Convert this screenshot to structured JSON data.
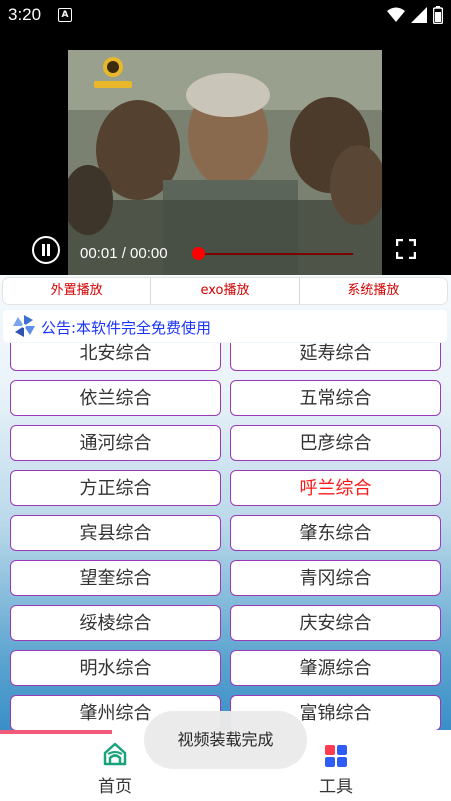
{
  "status_bar": {
    "time": "3:20",
    "notification_badge": "A"
  },
  "player": {
    "time_display": "00:01 / 00:00",
    "channel_logo_icon": "tv-station-logo"
  },
  "play_mode_tabs": [
    {
      "label": "外置播放"
    },
    {
      "label": "exo播放"
    },
    {
      "label": "系统播放"
    }
  ],
  "notice": {
    "text": "公告:本软件完全免费使用",
    "icon": "pinwheel-icon"
  },
  "channels": [
    {
      "label": "北安综合",
      "active": false
    },
    {
      "label": "延寿综合",
      "active": false
    },
    {
      "label": "依兰综合",
      "active": false
    },
    {
      "label": "五常综合",
      "active": false
    },
    {
      "label": "通河综合",
      "active": false
    },
    {
      "label": "巴彦综合",
      "active": false
    },
    {
      "label": "方正综合",
      "active": false
    },
    {
      "label": "呼兰综合",
      "active": true
    },
    {
      "label": "宾县综合",
      "active": false
    },
    {
      "label": "肇东综合",
      "active": false
    },
    {
      "label": "望奎综合",
      "active": false
    },
    {
      "label": "青冈综合",
      "active": false
    },
    {
      "label": "绥棱综合",
      "active": false
    },
    {
      "label": "庆安综合",
      "active": false
    },
    {
      "label": "明水综合",
      "active": false
    },
    {
      "label": "肇源综合",
      "active": false
    },
    {
      "label": "肇州综合",
      "active": false
    },
    {
      "label": "富锦综合",
      "active": false
    }
  ],
  "toast": {
    "text": "视频装载完成"
  },
  "bottom_nav": {
    "home_label": "首页",
    "tools_label": "工具"
  },
  "colors": {
    "active_channel": "#ff1a1a",
    "tab_text": "#d40000",
    "notice_text": "#1a33ff",
    "button_border": "#9a3ab8",
    "home_icon": "#1aa37a",
    "tools_icon_red": "#ff3b4f",
    "tools_icon_blue": "#2d5cf6"
  }
}
